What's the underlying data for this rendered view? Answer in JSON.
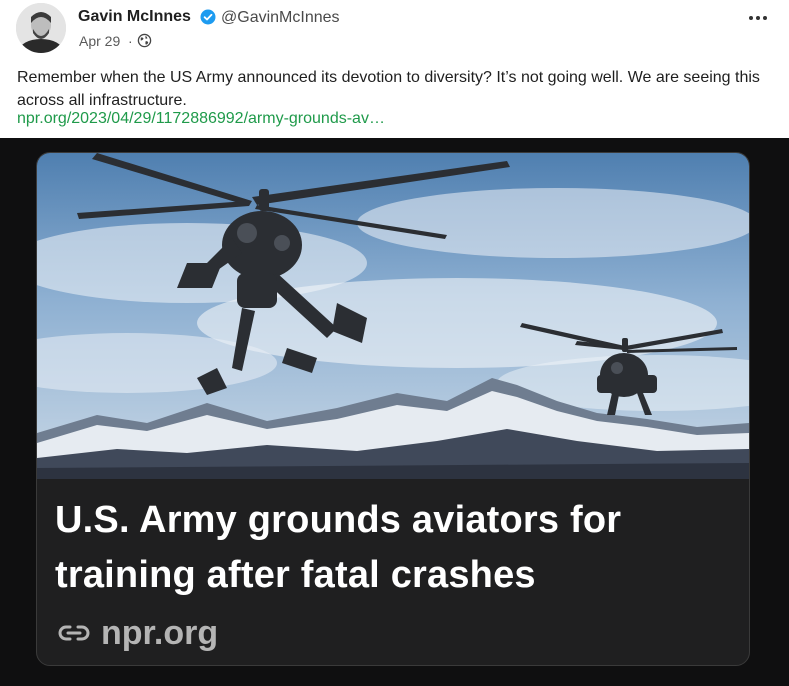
{
  "post": {
    "author_name": "Gavin McInnes",
    "author_handle": "@GavinMcInnes",
    "date": "Apr 29",
    "date_separator": "·",
    "text": "Remember when the US Army announced its devotion to diversity? It’s not going well. We are seeing this across all infrastructure.",
    "link_text": "npr.org/2023/04/29/1172886992/army-grounds-av…",
    "icons": {
      "verified": "verified-badge-icon",
      "visibility": "globe-icon",
      "more": "more-options-icon",
      "link": "link-chain-icon"
    }
  },
  "card": {
    "title": "U.S. Army grounds aviators for training after fatal crashes",
    "domain": "npr.org"
  },
  "colors": {
    "link": "#1f9a4a",
    "verified": "#1d9bf0",
    "card_bg": "#1f1f20"
  }
}
